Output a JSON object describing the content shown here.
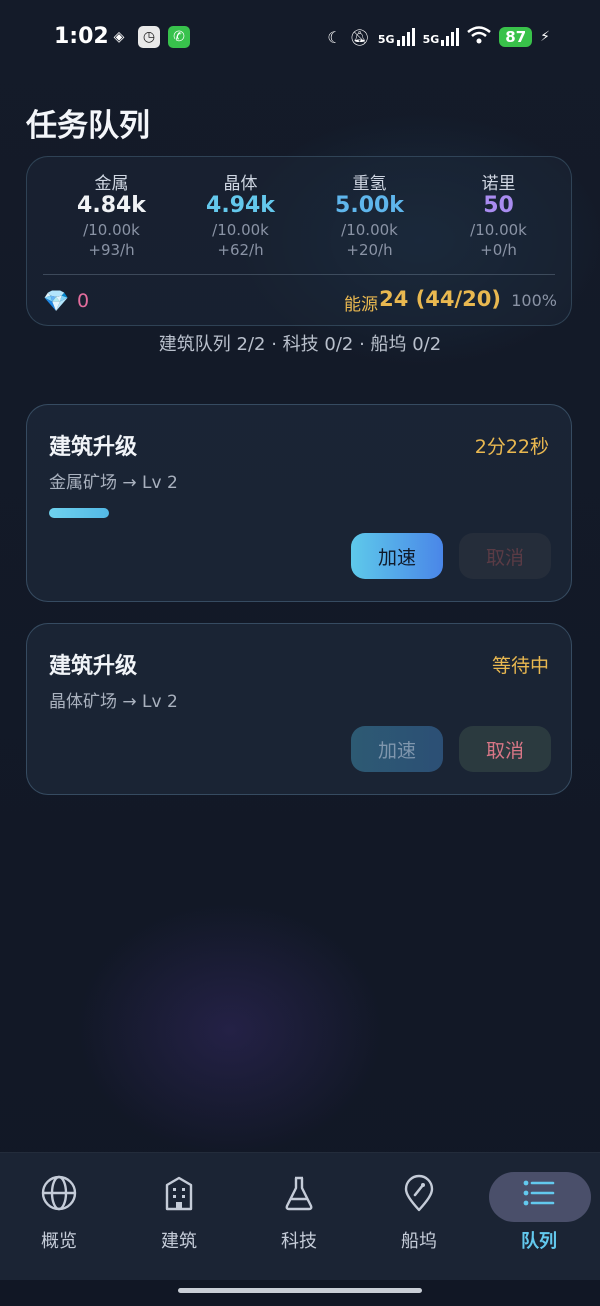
{
  "status_bar": {
    "time": "1:02",
    "network_1": "5G",
    "network_2": "5G",
    "battery": "87"
  },
  "page_title": "任务队列",
  "resources": [
    {
      "name": "金属",
      "value": "4.84k",
      "max": "/10.00k",
      "rate": "+93/h",
      "color": "#f0f2f5"
    },
    {
      "name": "晶体",
      "value": "4.94k",
      "max": "/10.00k",
      "rate": "+62/h",
      "color": "#64c8ec"
    },
    {
      "name": "重氢",
      "value": "5.00k",
      "max": "/10.00k",
      "rate": "+20/h",
      "color": "#5fb6ec"
    },
    {
      "name": "诺里",
      "value": "50",
      "max": "/10.00k",
      "rate": "+0/h",
      "color": "#a98cf0"
    }
  ],
  "gems": {
    "icon": "gem-icon",
    "value": "0"
  },
  "energy": {
    "label": "能源",
    "value": "24 (44/20)",
    "percent": "100%"
  },
  "queue_summary": "建筑队列 2/2 · 科技 0/2 · 船坞 0/2",
  "tasks": [
    {
      "title": "建筑升级",
      "status": "2分22秒",
      "subtitle": "金属矿场 → Lv 2",
      "progress": 0.12,
      "speed_label": "加速",
      "cancel_label": "取消"
    },
    {
      "title": "建筑升级",
      "status": "等待中",
      "subtitle": "晶体矿场 → Lv 2",
      "speed_label": "加速",
      "cancel_label": "取消"
    }
  ],
  "nav": [
    {
      "label": "概览",
      "icon": "globe-icon"
    },
    {
      "label": "建筑",
      "icon": "building-icon"
    },
    {
      "label": "科技",
      "icon": "flask-icon"
    },
    {
      "label": "船坞",
      "icon": "rocket-pin-icon"
    },
    {
      "label": "队列",
      "icon": "list-icon",
      "active": true
    }
  ],
  "colors": {
    "accent": "#63c9ee",
    "warning": "#e9b850",
    "danger": "#d87686"
  }
}
